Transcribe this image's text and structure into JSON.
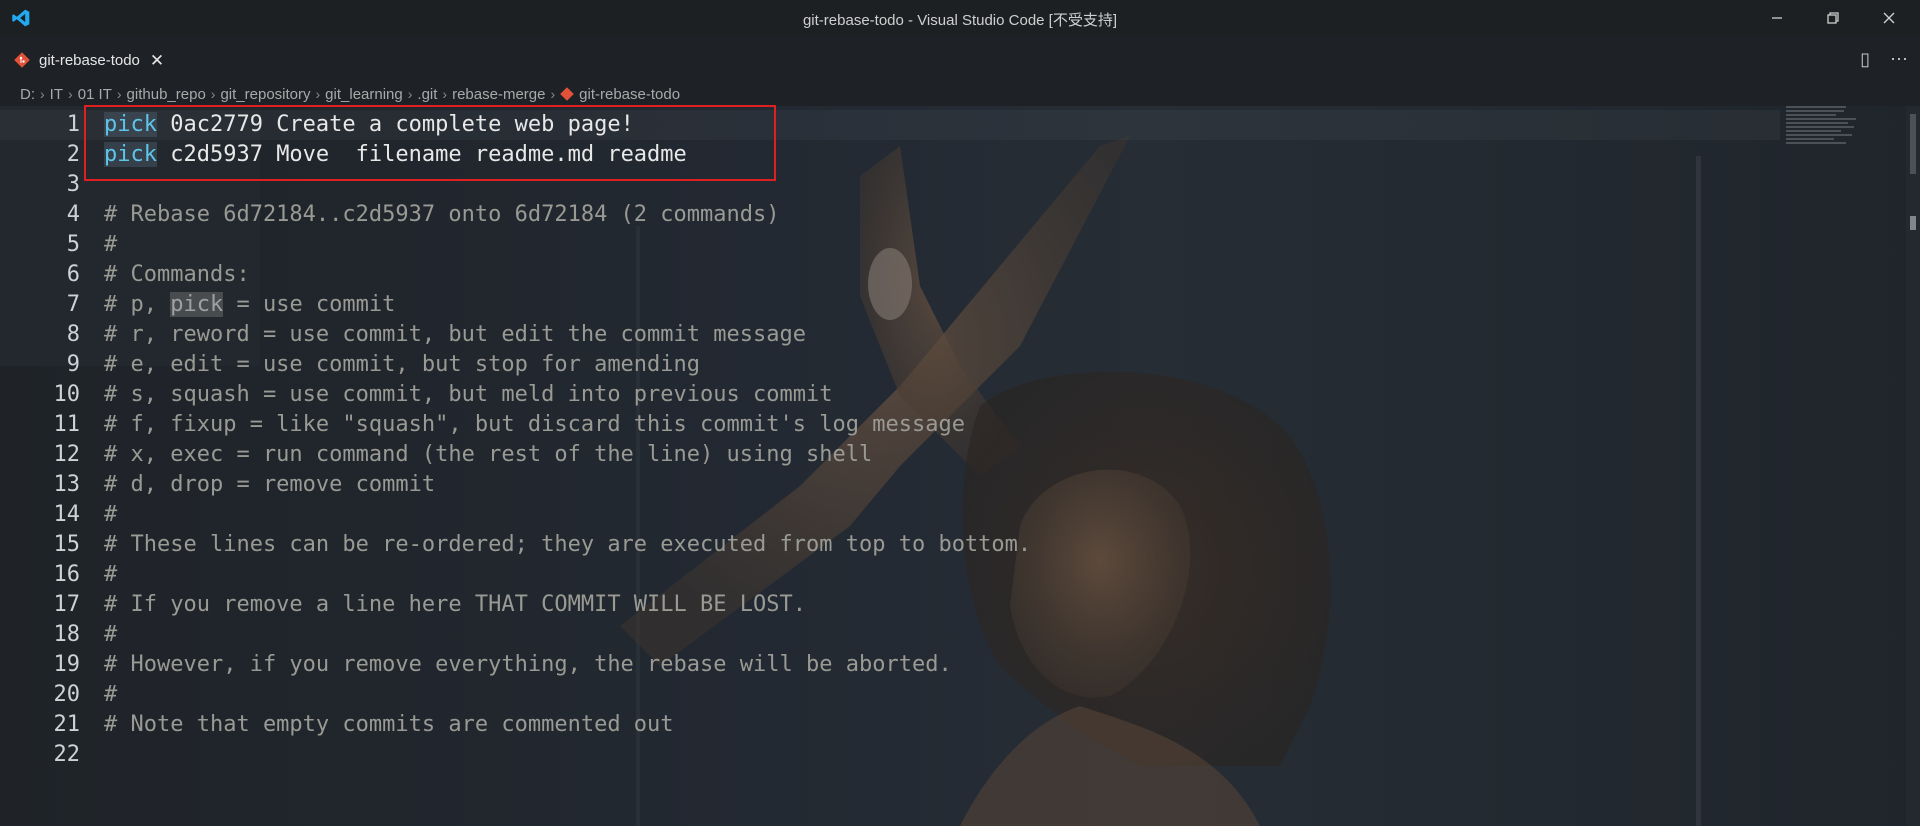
{
  "window": {
    "title": "git-rebase-todo - Visual Studio Code [不受支持]",
    "icons": {
      "logo": "vscode-logo-icon",
      "minimize": "minimize-icon",
      "restore": "restore-icon",
      "close": "close-icon"
    },
    "accent": "#23a9f2"
  },
  "tabs": [
    {
      "label": "git-rebase-todo",
      "icon": "git-file-icon",
      "close": "✕",
      "active": true
    }
  ],
  "tab_actions": {
    "split": "▯",
    "more": "⋯"
  },
  "breadcrumb": {
    "parts": [
      "D:",
      "IT",
      "01 IT",
      "github_repo",
      "git_repository",
      "git_learning",
      ".git",
      "rebase-merge",
      "git-rebase-todo"
    ],
    "separator": "›"
  },
  "editor": {
    "line_numbers": [
      "1",
      "2",
      "3",
      "4",
      "5",
      "6",
      "7",
      "8",
      "9",
      "10",
      "11",
      "12",
      "13",
      "14",
      "15",
      "16",
      "17",
      "18",
      "19",
      "20",
      "21",
      "22"
    ],
    "lines": [
      {
        "kw": "pick",
        "rest": " 0ac2779 Create a complete web page!"
      },
      {
        "kw": "pick",
        "rest": " c2d5937 Move  filename readme.md readme"
      },
      {
        "text": ""
      },
      {
        "text": "# Rebase 6d72184..c2d5937 onto 6d72184 (2 commands)"
      },
      {
        "text": "#"
      },
      {
        "text": "# Commands:"
      },
      {
        "pre": "# p, ",
        "hl": "pick",
        "post": " = use commit"
      },
      {
        "text": "# r, reword = use commit, but edit the commit message"
      },
      {
        "text": "# e, edit = use commit, but stop for amending"
      },
      {
        "text": "# s, squash = use commit, but meld into previous commit"
      },
      {
        "text": "# f, fixup = like \"squash\", but discard this commit's log message"
      },
      {
        "text": "# x, exec = run command (the rest of the line) using shell"
      },
      {
        "text": "# d, drop = remove commit"
      },
      {
        "text": "#"
      },
      {
        "text": "# These lines can be re-ordered; they are executed from top to bottom."
      },
      {
        "text": "#"
      },
      {
        "text": "# If you remove a line here THAT COMMIT WILL BE LOST."
      },
      {
        "text": "#"
      },
      {
        "text": "# However, if you remove everything, the rebase will be aborted."
      },
      {
        "text": "#"
      },
      {
        "text": "# Note that empty commits are commented out"
      },
      {
        "text": ""
      }
    ],
    "colors": {
      "keyword": "#5ec4ea",
      "comment": "#9a9a94",
      "text": "#e8e8e8",
      "highlight_box": "#e02020"
    }
  }
}
